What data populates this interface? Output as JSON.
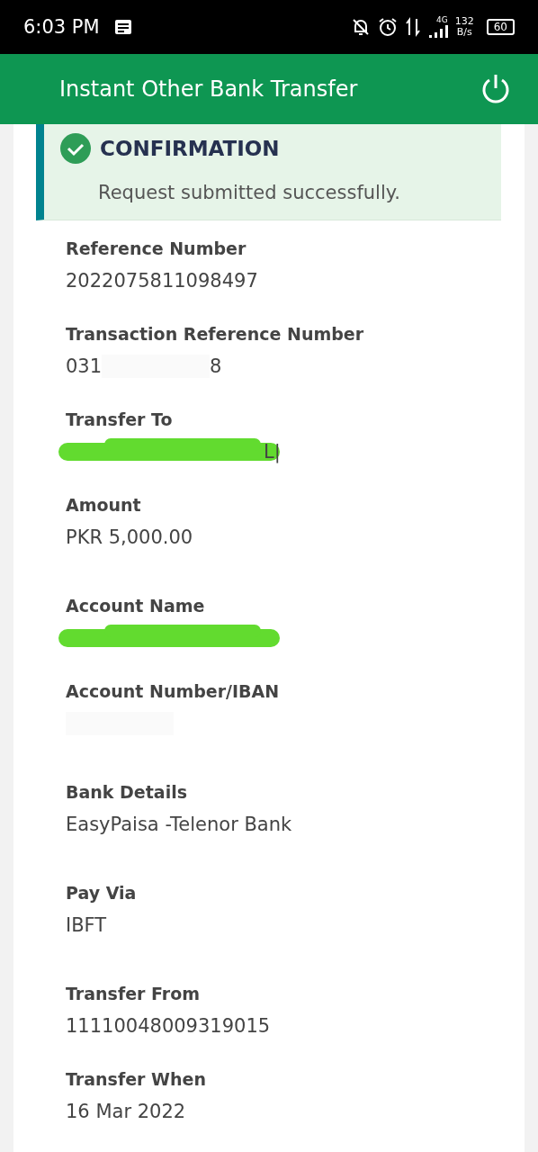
{
  "status_bar": {
    "time": "6:03 PM",
    "network": "4G",
    "speed": "132",
    "speed_unit": "B/s",
    "battery": "60"
  },
  "header": {
    "title": "Instant Other Bank Transfer"
  },
  "confirmation": {
    "title": "CONFIRMATION",
    "message": "Request submitted successfully."
  },
  "fields": [
    {
      "label": "Reference Number",
      "kind": "plain",
      "value": "2022075811098497"
    },
    {
      "label": "Transaction Reference Number",
      "kind": "blurred",
      "parts": [
        "031",
        "8"
      ]
    },
    {
      "label": "Transfer To",
      "kind": "scribbled",
      "value": "L|"
    },
    {
      "label": "Amount",
      "kind": "plain",
      "value": "PKR 5,000.00"
    },
    {
      "label": "Account Name",
      "kind": "scribbled"
    },
    {
      "label": "Account Number/IBAN",
      "kind": "blurred"
    },
    {
      "label": "Bank Details",
      "kind": "plain",
      "value": "EasyPaisa -Telenor Bank"
    },
    {
      "label": "Pay Via",
      "kind": "plain",
      "value": "IBFT"
    },
    {
      "label": "Transfer From",
      "kind": "plain",
      "value": "11110048009319015"
    },
    {
      "label": "Transfer When",
      "kind": "plain",
      "value": "16 Mar 2022"
    }
  ]
}
